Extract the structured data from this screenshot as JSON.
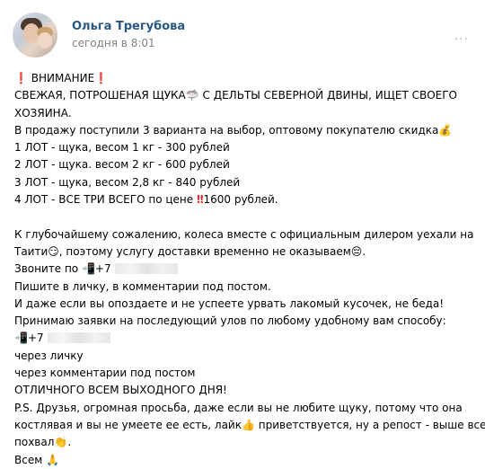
{
  "post": {
    "author": "Ольга Трегубова",
    "time": "сегодня в 8:01",
    "more": "···",
    "lines": {
      "l1": "ВНИМАНИЕ",
      "l2a": "СВЕЖАЯ, ПОТРОШЕНАЯ ЩУКА",
      "l2b": "С ДЕЛЬТЫ СЕВЕРНОЙ ДВИНЫ, ИЩЕТ СВОЕГО",
      "l3": "ХОЗЯИНА.",
      "l4": "В продажу поступили 3 варианта на выбор, оптовому покупателю скидка",
      "l5": "1 ЛОТ - щука, весом 1 кг - 300 рублей",
      "l6": "2 ЛОТ - щука. весом 2 кг - 600 рублей",
      "l7": "3 ЛОТ - щука, весом 2,8 кг - 840 рублей",
      "l8a": "4 ЛОТ - ВСЕ ТРИ ВСЕГО по цене",
      "l8b": "1600 рублей.",
      "l9": "К глубочайшему сожалению, колеса вместе с официальным дилером уехали на",
      "l10a": "Таити",
      "l10b": ", поэтому услугу доставки временно не оказываем",
      "l10c": ".",
      "l11a": "Звоните по",
      "l11b": "+7",
      "l12": "Пишите в личку, в комментарии под постом.",
      "l13": "И даже если вы опоздаете и не успеете урвать лакомый кусочек, не беда!",
      "l14": "Принимаю заявки на последующий улов по любому удобному вам способу:",
      "l15": "+7",
      "l16": "через личку",
      "l17": "через комментарии под постом",
      "l18": "ОТЛИЧНОГО ВСЕМ ВЫХОДНОГО ДНЯ!",
      "l19": "P.S. Друзья, огромная просьба, даже если вы не любите щуку, потому что она",
      "l20a": "костлявая и вы не умеете ее есть, лайк",
      "l20b": "приветствуется, ну а репост - выше всех",
      "l21a": "похвал",
      "l21b": ".",
      "l22": "Всем"
    },
    "emoji": {
      "exclaim": "❗",
      "shark": "🦈",
      "money": "💰",
      "double_exclaim": "‼",
      "smirk": "😏",
      "pensive": "😔",
      "phone": "📲",
      "thumbs": "👍",
      "clap": "👏",
      "pray": "🙏"
    }
  }
}
